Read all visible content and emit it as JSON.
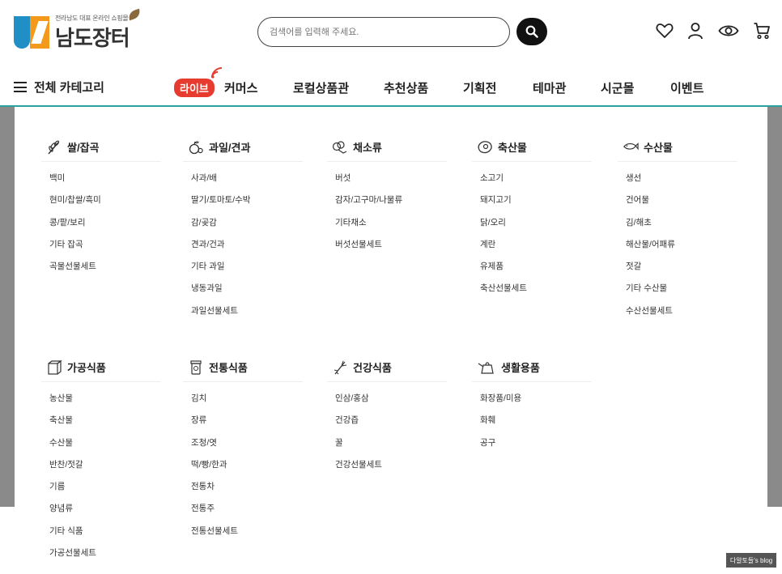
{
  "logo": {
    "subtitle": "전라남도 대표 온라인 쇼핑몰",
    "name": "남도장터"
  },
  "search": {
    "placeholder": "검색어를 입력해 주세요."
  },
  "header_icons": [
    "heart-icon",
    "user-icon",
    "eye-icon",
    "cart-icon"
  ],
  "nav": {
    "all_categories": "전체 카테고리",
    "live_badge": "라이브",
    "items": [
      "커머스",
      "로컬상품관",
      "추천상품",
      "기획전",
      "테마관",
      "시군몰",
      "이벤트"
    ]
  },
  "categories": [
    {
      "title": "쌀/잡곡",
      "icon": "grain-icon",
      "items": [
        "백미",
        "현미/찹쌀/흑미",
        "콩/팥/보리",
        "기타 잡곡",
        "곡물선물세트"
      ]
    },
    {
      "title": "과일/견과",
      "icon": "fruit-icon",
      "items": [
        "사과/배",
        "딸기/토마토/수박",
        "감/곶감",
        "견과/건과",
        "기타 과일",
        "냉동과일",
        "과일선물세트"
      ]
    },
    {
      "title": "채소류",
      "icon": "vegetable-icon",
      "items": [
        "버섯",
        "감자/고구마/나물류",
        "기타채소",
        "버섯선물세트"
      ]
    },
    {
      "title": "축산물",
      "icon": "meat-icon",
      "items": [
        "소고기",
        "돼지고기",
        "닭/오리",
        "계란",
        "유제품",
        "축산선물세트"
      ]
    },
    {
      "title": "수산물",
      "icon": "seafood-icon",
      "items": [
        "생선",
        "건어물",
        "김/해초",
        "해산물/어패류",
        "젓갈",
        "기타 수산물",
        "수산선물세트"
      ]
    },
    {
      "title": "가공식품",
      "icon": "processed-food-icon",
      "items": [
        "농산물",
        "축산물",
        "수산물",
        "반찬/젓갈",
        "기름",
        "양념류",
        "기타 식품",
        "가공선물세트"
      ]
    },
    {
      "title": "전통식품",
      "icon": "jar-icon",
      "items": [
        "김치",
        "장류",
        "조청/엿",
        "떡/빵/한과",
        "전통차",
        "전통주",
        "전통선물세트"
      ]
    },
    {
      "title": "건강식품",
      "icon": "ginseng-icon",
      "items": [
        "인삼/홍삼",
        "건강즙",
        "꿀",
        "건강선물세트"
      ]
    },
    {
      "title": "생활용품",
      "icon": "kettle-icon",
      "items": [
        "화장품/미용",
        "화훼",
        "공구"
      ]
    }
  ],
  "watermark": "다알토들's blog",
  "colors": {
    "accent_line": "#2aa3a0",
    "live_red": "#e63b2e",
    "logo_blue": "#1f8fc6",
    "logo_orange": "#f39a1e"
  }
}
